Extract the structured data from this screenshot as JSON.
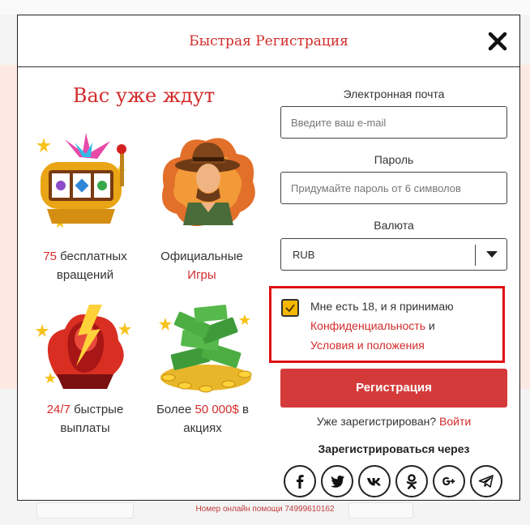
{
  "modal": {
    "title": "Быстрая Регистрация",
    "close_icon": "close-icon"
  },
  "promo": {
    "heading": "Вас уже ждут",
    "features": [
      {
        "icon": "slot-machine-image",
        "highlight": "75",
        "text": " бесплатных вращений"
      },
      {
        "icon": "adventurer-image",
        "text_before": "Официальные",
        "highlight": "Игры"
      },
      {
        "icon": "lightning-hero-image",
        "highlight": "24/7",
        "text": " быстрые выплаты"
      },
      {
        "icon": "money-pile-image",
        "text_before": "Более ",
        "highlight": "50 000$",
        "text_after": " в акциях"
      }
    ]
  },
  "form": {
    "email_label": "Электронная почта",
    "email_placeholder": "Введите ваш e-mail",
    "email_value": "",
    "password_label": "Пароль",
    "password_placeholder": "Придумайте пароль от 6 символов",
    "password_value": "",
    "currency_label": "Валюта",
    "currency_value": "RUB",
    "agree_text": "Мне есть 18, и я принимаю",
    "privacy_link": "Конфиденциальность",
    "and_text": " и",
    "terms_link": "Условия и положения",
    "agree_checked": true,
    "submit_label": "Регистрация",
    "already_text": "Уже зарегистрирован? ",
    "login_link": "Войти",
    "register_via": "Зарегистрироваться через",
    "socials": [
      "facebook-icon",
      "twitter-icon",
      "vk-icon",
      "odnoklassniki-icon",
      "google-plus-icon",
      "telegram-icon"
    ]
  },
  "footer": {
    "help_text": "Номер онлайн помощи 74999610162"
  },
  "colors": {
    "accent": "#d22b2b",
    "button": "#d53a3a",
    "checkbox": "#f5b700",
    "highlight_border": "#e01111"
  }
}
